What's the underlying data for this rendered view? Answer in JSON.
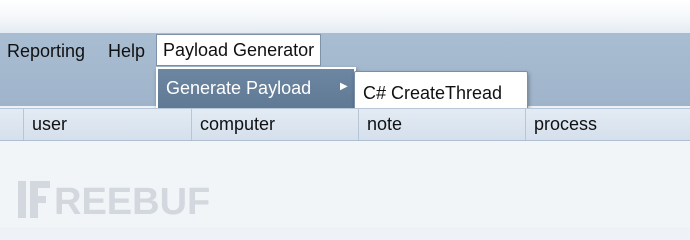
{
  "menubar": {
    "items": [
      "Reporting",
      "Help",
      "Payload Generator"
    ]
  },
  "submenu": {
    "label": "Generate Payload",
    "arrow_icon": "chevron-right-icon"
  },
  "flyout": {
    "label": "C# CreateThread"
  },
  "table": {
    "columns": [
      "user",
      "computer",
      "note",
      "process"
    ]
  },
  "watermark": {
    "text": "FREEBUF"
  },
  "colors": {
    "menubar": "#a9bdd2",
    "submenu_bg": "#6d86a1",
    "header_bg": "#dbe4ef"
  }
}
